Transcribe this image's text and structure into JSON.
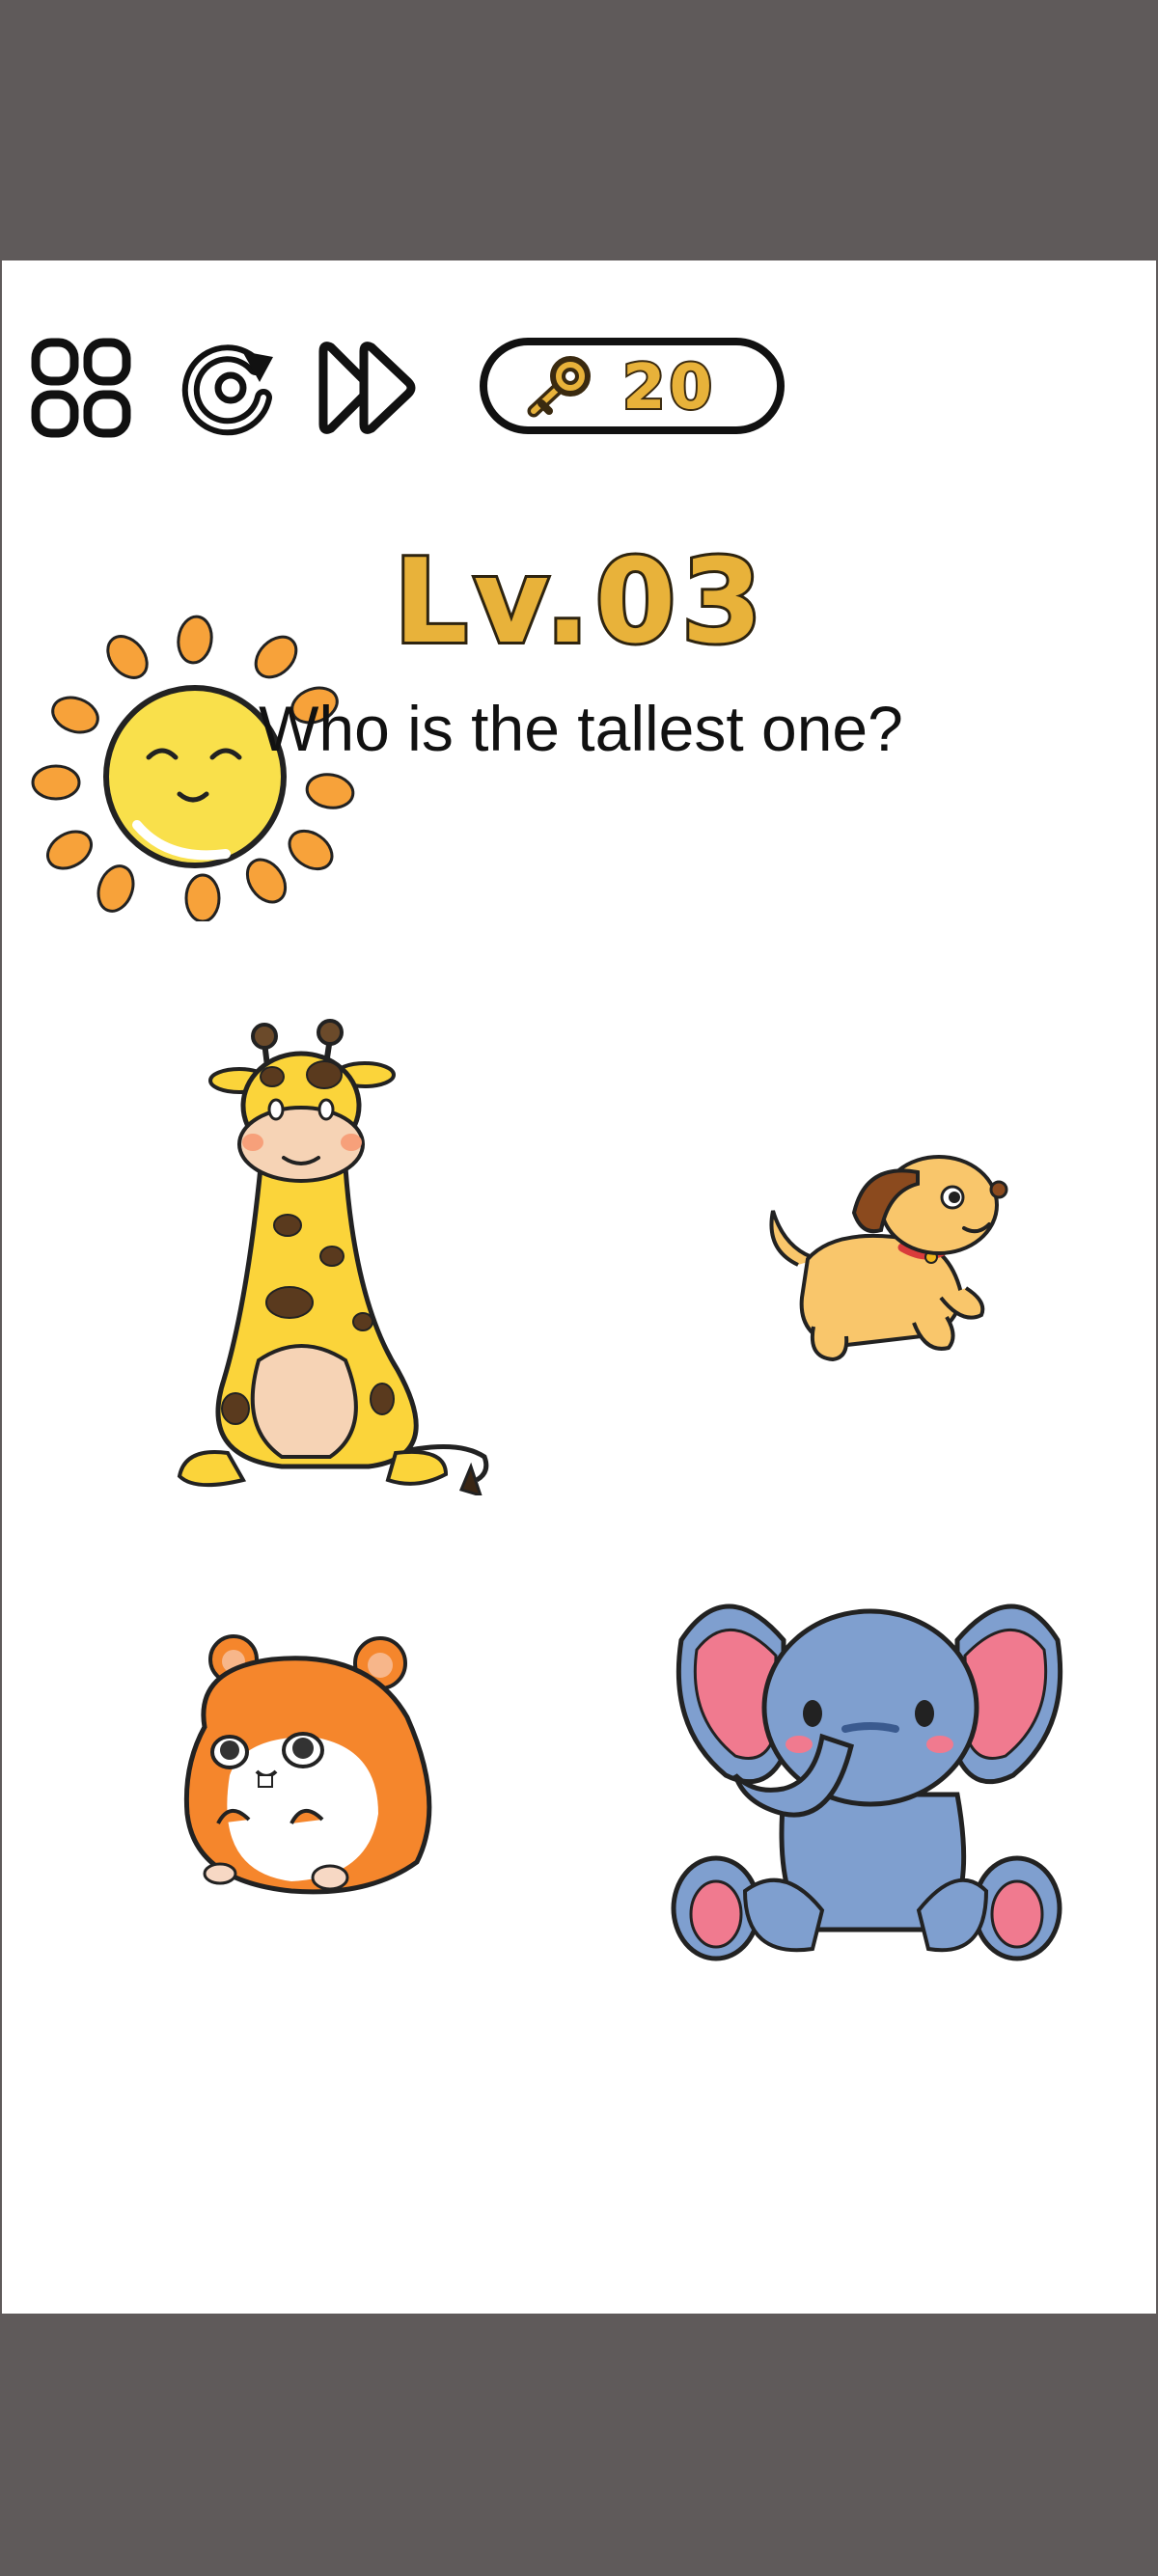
{
  "toolbar": {
    "menu_icon": "grid-menu-icon",
    "restart_icon": "restart-icon",
    "skip_icon": "fast-forward-icon",
    "key_icon": "key-icon",
    "key_count": "20"
  },
  "level": {
    "title": "Lv.03",
    "question": "Who is the tallest one?"
  },
  "scene": {
    "items": [
      {
        "name": "sun",
        "icon": "sun-icon"
      },
      {
        "name": "giraffe",
        "icon": "giraffe-icon"
      },
      {
        "name": "dog",
        "icon": "dog-icon"
      },
      {
        "name": "hamster",
        "icon": "hamster-icon"
      },
      {
        "name": "elephant",
        "icon": "elephant-icon"
      }
    ]
  },
  "colors": {
    "frame": "#5f5a5a",
    "accent": "#e8b23a",
    "sun": "#f9e04b",
    "sun_rays": "#f7a23a",
    "giraffe": "#fbd43a",
    "dog": "#f9c66b",
    "hamster": "#f5862c",
    "elephant": "#7f9fcf",
    "elephant_ear": "#f07a8f"
  }
}
